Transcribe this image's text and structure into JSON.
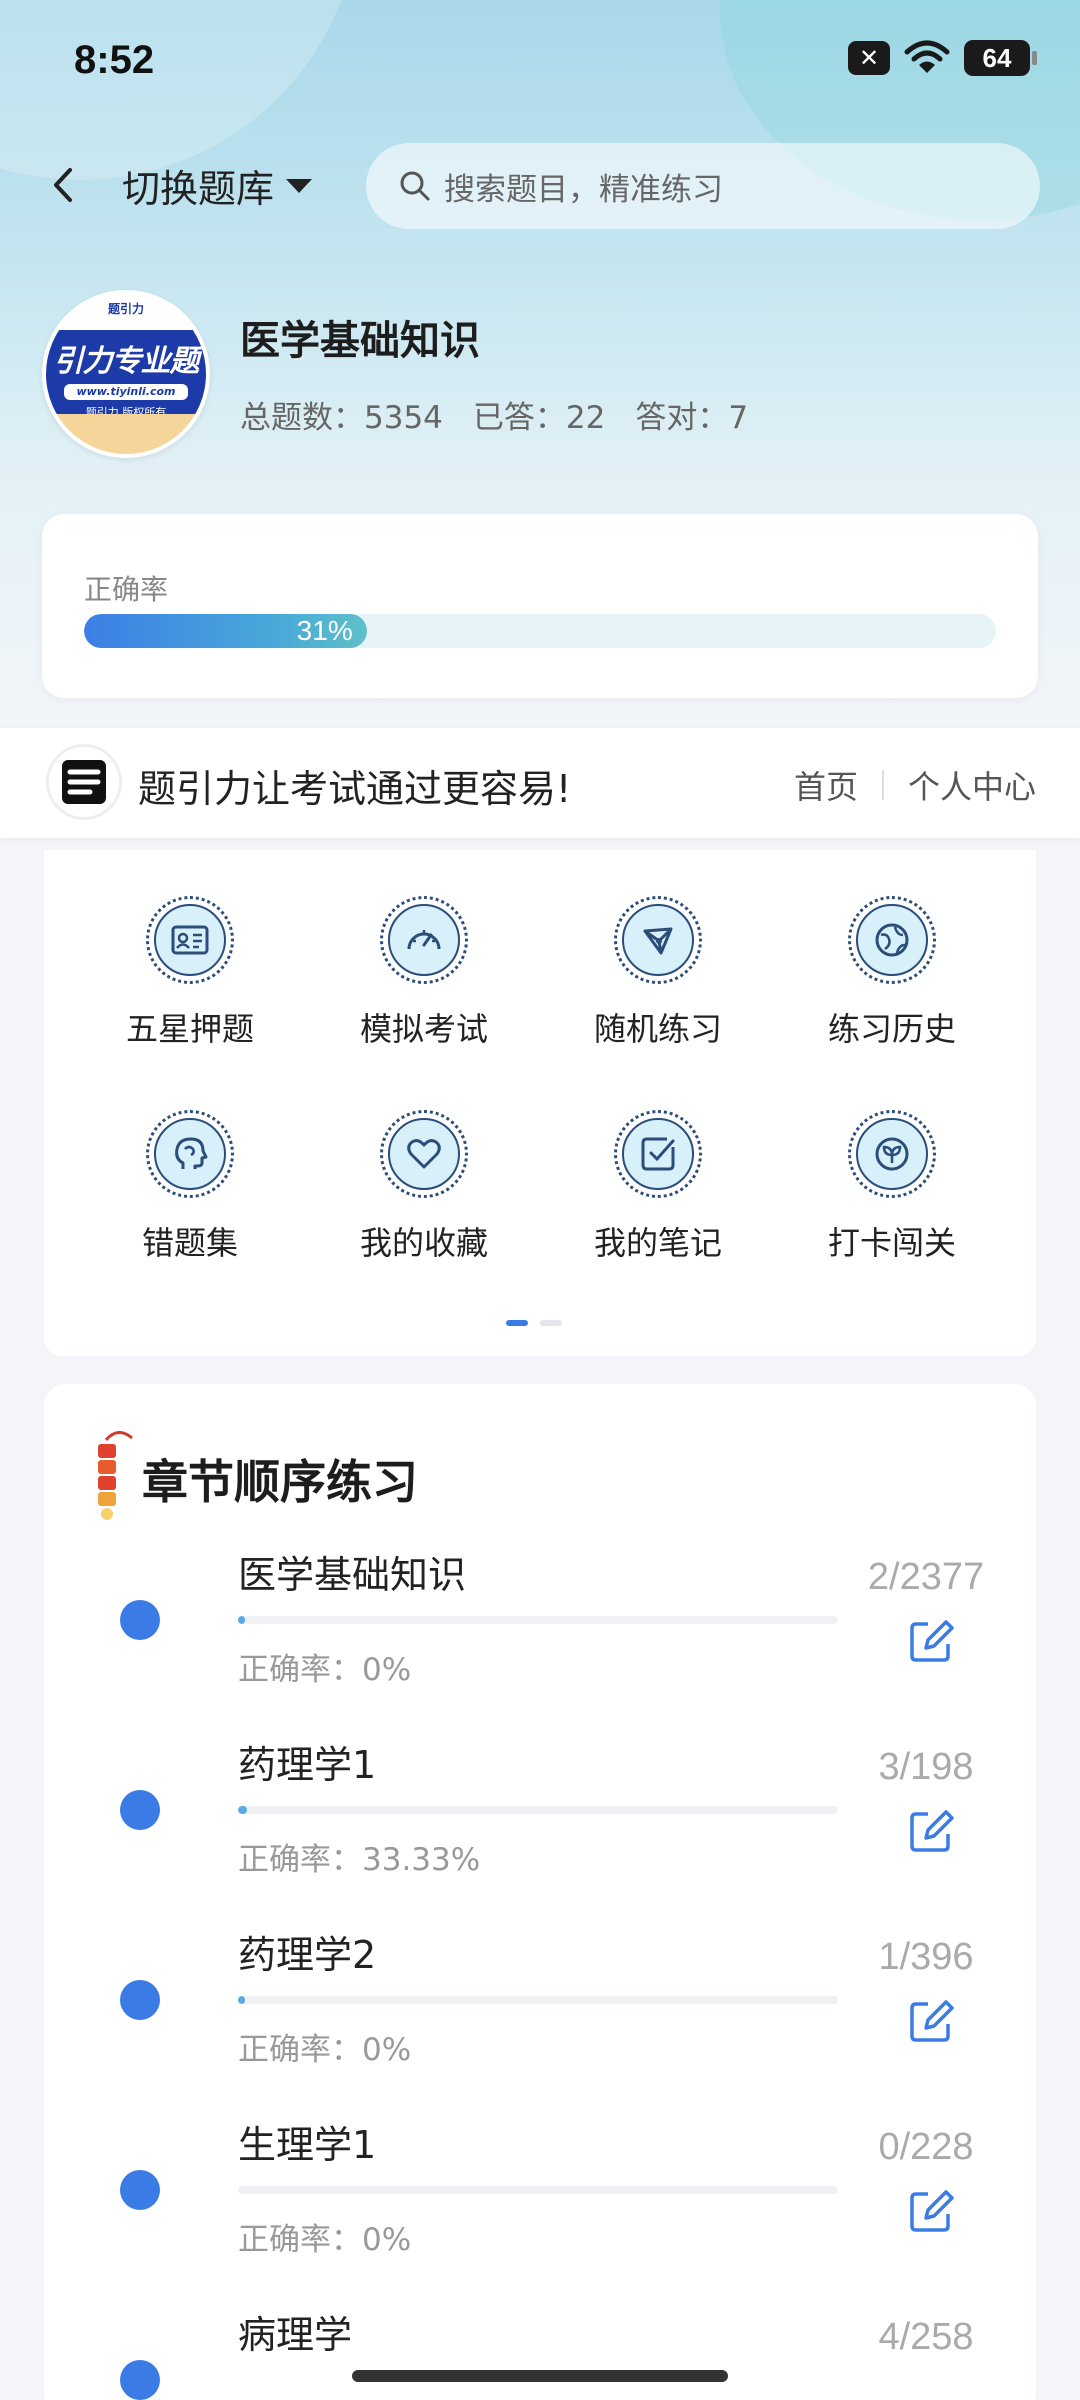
{
  "status_bar": {
    "time": "8:52",
    "battery": "64"
  },
  "top_nav": {
    "switch_label": "切换题库",
    "search_placeholder": "搜索题目，精准练习"
  },
  "bank": {
    "logo_title": "引力专业题",
    "logo_url": "www.tiyinli.com",
    "logo_sub": "题引力 版权所有",
    "title": "医学基础知识",
    "total_label": "总题数：5354",
    "answered_label": "已答：22",
    "correct_label": "答对：7"
  },
  "accuracy": {
    "label": "正确率",
    "value_text": "31%",
    "value": 0.31
  },
  "banner": {
    "text": "题引力让考试通过更容易!",
    "home": "首页",
    "profile": "个人中心"
  },
  "features": [
    {
      "label": "五星押题",
      "icon": "id-card-icon"
    },
    {
      "label": "模拟考试",
      "icon": "speedometer-icon"
    },
    {
      "label": "随机练习",
      "icon": "network-icon"
    },
    {
      "label": "练习历史",
      "icon": "globe-icon"
    },
    {
      "label": "错题集",
      "icon": "brain-head-icon"
    },
    {
      "label": "我的收藏",
      "icon": "heart-icon"
    },
    {
      "label": "我的笔记",
      "icon": "note-check-icon"
    },
    {
      "label": "打卡闯关",
      "icon": "sprout-icon"
    }
  ],
  "chapters": {
    "title": "章节顺序练习",
    "items": [
      {
        "name": "医学基础知识",
        "accuracy": "正确率：0%",
        "count": "2/2377",
        "progress": 0.0008
      },
      {
        "name": "药理学1",
        "accuracy": "正确率：33.33%",
        "count": "3/198",
        "progress": 0.015
      },
      {
        "name": "药理学2",
        "accuracy": "正确率：0%",
        "count": "1/396",
        "progress": 0.0025
      },
      {
        "name": "生理学1",
        "accuracy": "正确率：0%",
        "count": "0/228",
        "progress": 0
      },
      {
        "name": "病理学",
        "accuracy": "",
        "count": "4/258",
        "progress": 0.0155
      }
    ]
  },
  "colors": {
    "accent": "#3b7be6",
    "icon_fill": "#d8f0fa",
    "icon_stroke": "#2b4d7a"
  }
}
